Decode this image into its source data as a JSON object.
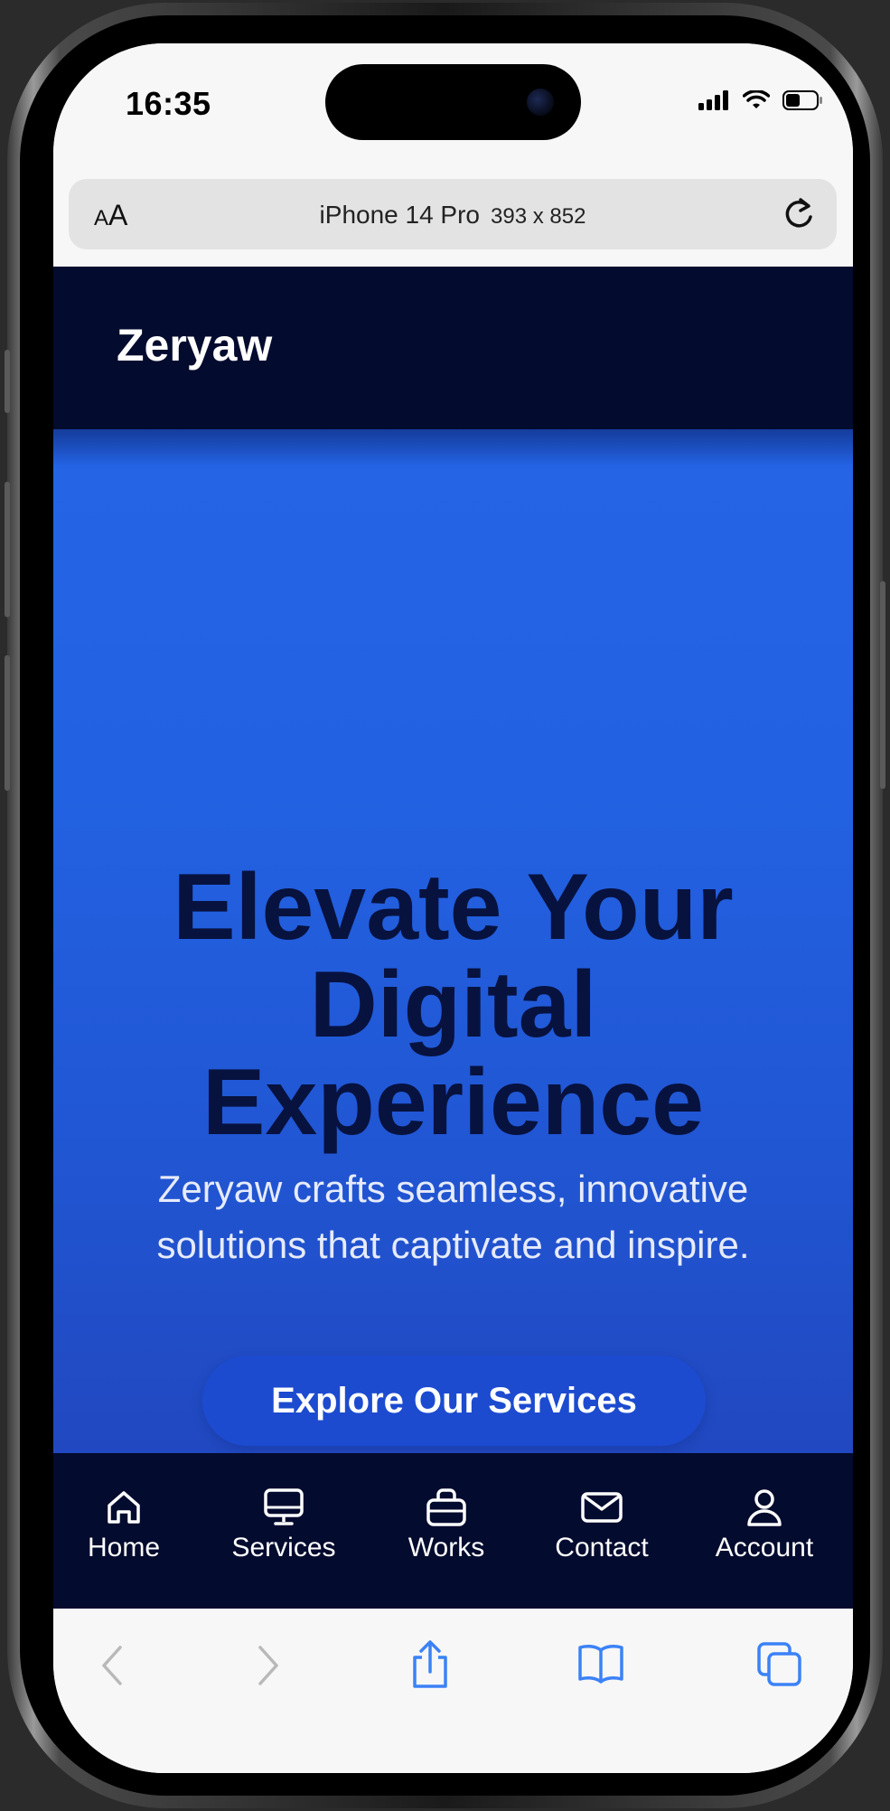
{
  "status_bar": {
    "time": "16:35"
  },
  "browser": {
    "text_size_label": "AA",
    "device_name": "iPhone 14 Pro",
    "device_dims": "393 x 852"
  },
  "header": {
    "brand": "Zeryaw"
  },
  "hero": {
    "title": "Elevate Your Digital Experience",
    "subtitle": "Zeryaw crafts seamless, innovative solutions that captivate and inspire.",
    "cta_label": "Explore Our Services"
  },
  "bottom_nav": {
    "items": [
      {
        "label": "Home",
        "icon": "home-icon"
      },
      {
        "label": "Services",
        "icon": "monitor-icon"
      },
      {
        "label": "Works",
        "icon": "briefcase-icon"
      },
      {
        "label": "Contact",
        "icon": "mail-icon"
      },
      {
        "label": "Account",
        "icon": "user-icon"
      }
    ]
  },
  "toolbar": {
    "icons": [
      "back-icon",
      "forward-icon",
      "share-icon",
      "bookmarks-icon",
      "tabs-icon"
    ]
  },
  "colors": {
    "header_bg": "#030b2e",
    "hero_bg": "#2262e2",
    "hero_title": "#07123f",
    "cta_bg": "#1c4bd0",
    "toolbar_accent": "#3b82f6"
  }
}
